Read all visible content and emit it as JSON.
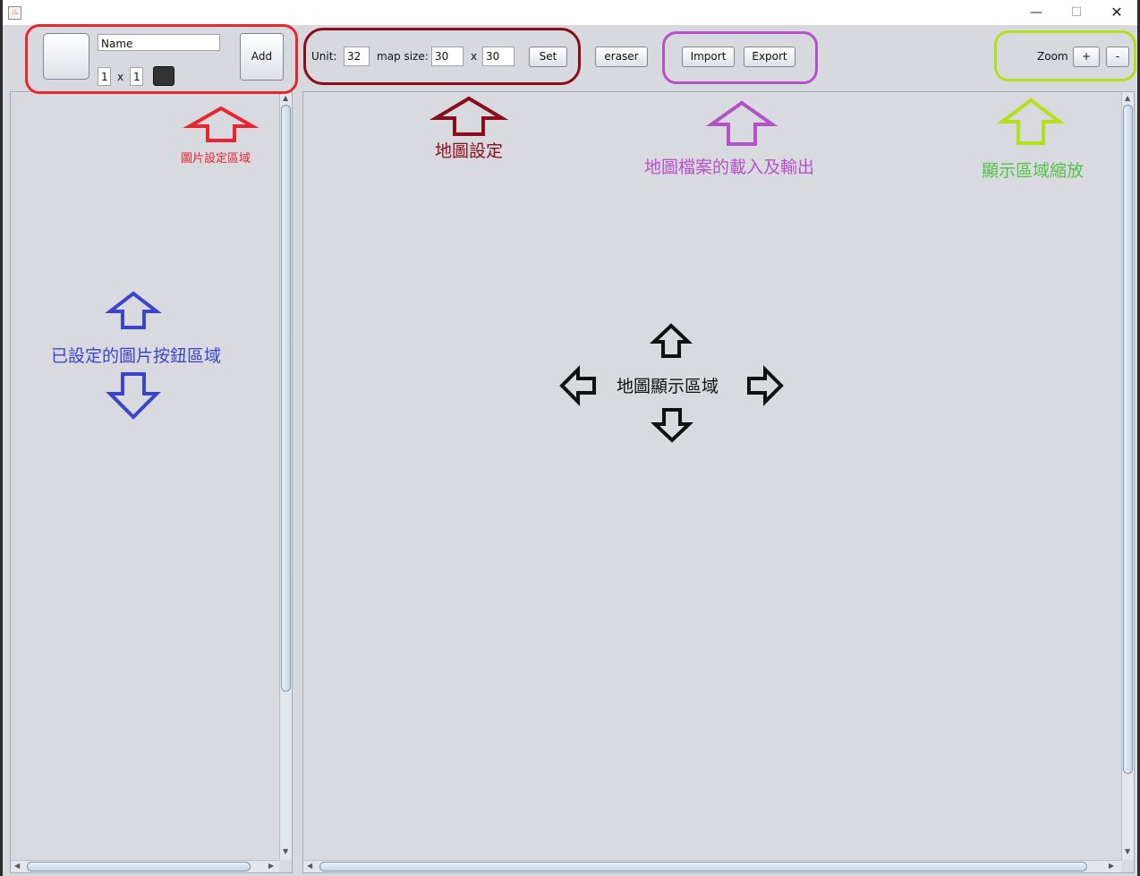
{
  "window": {
    "app_icon": "java-cup-icon",
    "controls": {
      "minimize": "—",
      "maximize": "☐",
      "close": "✕"
    }
  },
  "image_settings": {
    "name_value": "Name",
    "width_value": "1",
    "times": "x",
    "height_value": "1",
    "add_label": "Add"
  },
  "map_settings": {
    "unit_label": "Unit:",
    "unit_value": "32",
    "map_size_label": "map size:",
    "width_value": "30",
    "times": "x",
    "height_value": "30",
    "set_label": "Set"
  },
  "tools": {
    "eraser_label": "eraser"
  },
  "file": {
    "import_label": "Import",
    "export_label": "Export"
  },
  "zoom": {
    "label": "Zoom",
    "plus_label": "+",
    "minus_label": "-"
  },
  "annotations": {
    "image_settings_area": "圖片設定區域",
    "map_settings": "地圖設定",
    "map_file_io": "地圖檔案的載入及輸出",
    "zoom_area": "顯示區域縮放",
    "image_buttons_area": "已設定的圖片按鈕區域",
    "map_display_area": "地圖顯示區域"
  },
  "colors": {
    "red": "#e8262e",
    "dark_red": "#8b0d1c",
    "purple": "#b651c8",
    "lime": "#b3e01b",
    "blue": "#3b45c9",
    "green_text": "#55c24a",
    "black": "#111111"
  }
}
